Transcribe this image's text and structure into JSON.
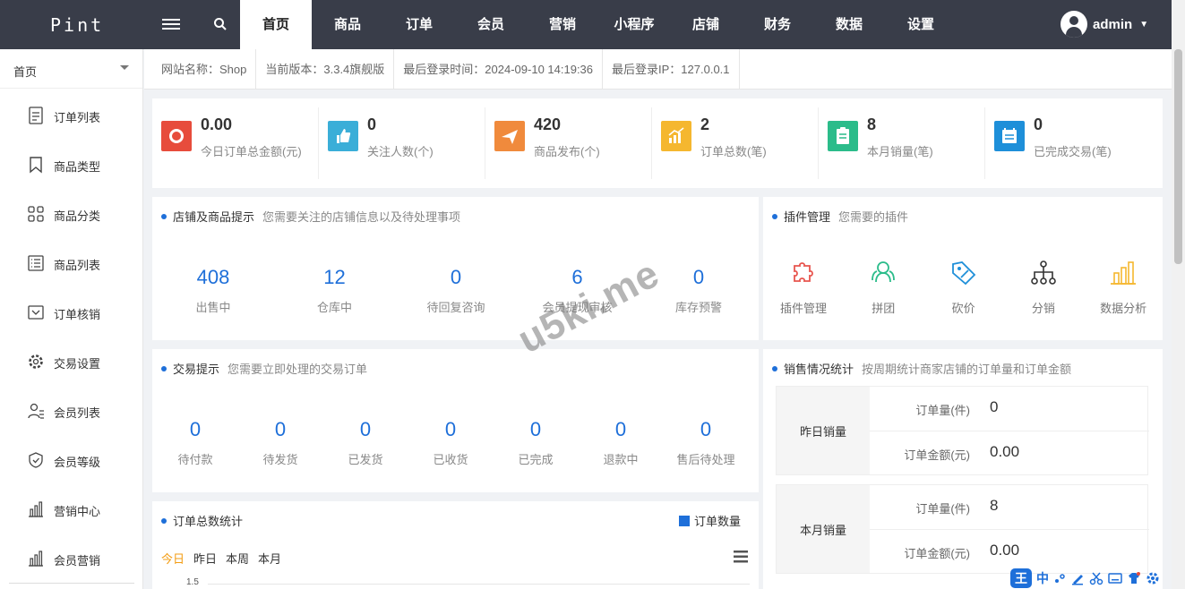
{
  "app": {
    "logo": "Pint"
  },
  "topnav": {
    "items": [
      "首页",
      "商品",
      "订单",
      "会员",
      "营销",
      "小程序",
      "店铺",
      "财务",
      "数据",
      "设置"
    ],
    "active": 0,
    "user": "admin"
  },
  "sidebar": {
    "header": "首页",
    "items": [
      "订单列表",
      "商品类型",
      "商品分类",
      "商品列表",
      "订单核销",
      "交易设置",
      "会员列表",
      "会员等级",
      "营销中心",
      "会员营销"
    ]
  },
  "infobar": {
    "site_name": "网站名称：Shop",
    "version": "当前版本：3.3.4旗舰版",
    "last_login_time": "最后登录时间：2024-09-10 14:19:36",
    "last_login_ip": "最后登录IP：127.0.0.1"
  },
  "stats": [
    {
      "value": "0.00",
      "label": "今日订单总金额(元)",
      "color": "#e74c3c",
      "icon": "money-icon"
    },
    {
      "value": "0",
      "label": "关注人数(个)",
      "color": "#3aaed8",
      "icon": "thumbs-up-icon"
    },
    {
      "value": "420",
      "label": "商品发布(个)",
      "color": "#f08a3c",
      "icon": "paper-plane-icon"
    },
    {
      "value": "2",
      "label": "订单总数(笔)",
      "color": "#f5b72f",
      "icon": "trend-chart-icon"
    },
    {
      "value": "8",
      "label": "本月销量(笔)",
      "color": "#2bbc8a",
      "icon": "clipboard-icon"
    },
    {
      "value": "0",
      "label": "已完成交易(笔)",
      "color": "#1e8fd9",
      "icon": "calendar-icon"
    }
  ],
  "shop_tips": {
    "title": "店铺及商品提示",
    "subtitle": "您需要关注的店铺信息以及待处理事项",
    "items": [
      {
        "value": "408",
        "label": "出售中"
      },
      {
        "value": "12",
        "label": "仓库中"
      },
      {
        "value": "0",
        "label": "待回复咨询"
      },
      {
        "value": "6",
        "label": "会员提现审核"
      },
      {
        "value": "0",
        "label": "库存预警"
      }
    ]
  },
  "plugins": {
    "title": "插件管理",
    "subtitle": "您需要的插件",
    "items": [
      {
        "label": "插件管理",
        "icon": "puzzle-icon",
        "color": "#e8554e"
      },
      {
        "label": "拼团",
        "icon": "group-icon",
        "color": "#2bbc8a"
      },
      {
        "label": "砍价",
        "icon": "price-tag-icon",
        "color": "#1e8fd9"
      },
      {
        "label": "分销",
        "icon": "distribution-icon",
        "color": "#333333"
      },
      {
        "label": "数据分析",
        "icon": "bar-chart-icon",
        "color": "#f5b72f"
      }
    ]
  },
  "trade_tips": {
    "title": "交易提示",
    "subtitle": "您需要立即处理的交易订单",
    "items": [
      {
        "value": "0",
        "label": "待付款"
      },
      {
        "value": "0",
        "label": "待发货"
      },
      {
        "value": "0",
        "label": "已发货"
      },
      {
        "value": "0",
        "label": "已收货"
      },
      {
        "value": "0",
        "label": "已完成"
      },
      {
        "value": "0",
        "label": "退款中"
      },
      {
        "value": "0",
        "label": "售后待处理"
      }
    ]
  },
  "sales": {
    "title": "销售情况统计",
    "subtitle": "按周期统计商家店铺的订单量和订单金额",
    "rows": [
      {
        "label": "昨日销量",
        "qty_label": "订单量(件)",
        "qty": "0",
        "amt_label": "订单金额(元)",
        "amt": "0.00"
      },
      {
        "label": "本月销量",
        "qty_label": "订单量(件)",
        "qty": "8",
        "amt_label": "订单金额(元)",
        "amt": "0.00"
      }
    ]
  },
  "order_chart": {
    "title": "订单总数统计",
    "legend": "订单数量",
    "tabs": [
      "今日",
      "昨日",
      "本周",
      "本月"
    ],
    "active_tab": 0,
    "y_tick_top": "1.5"
  },
  "ime": {
    "logo": "王",
    "mode": "中"
  },
  "watermark": "u5ki.me"
}
